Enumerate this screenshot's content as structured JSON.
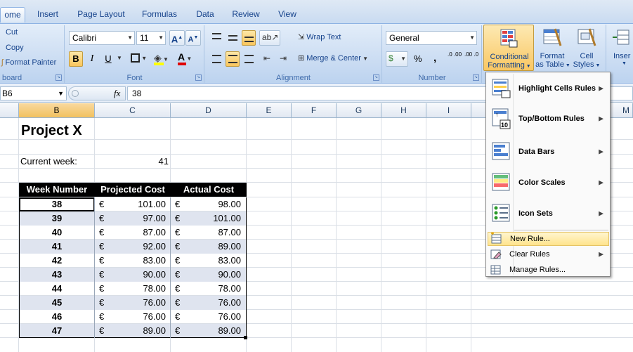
{
  "tabs": {
    "home": "ome",
    "insert": "Insert",
    "page_layout": "Page Layout",
    "formulas": "Formulas",
    "data": "Data",
    "review": "Review",
    "view": "View"
  },
  "clipboard": {
    "cut": "Cut",
    "copy": "Copy",
    "format_painter": "Format Painter",
    "label": "board"
  },
  "font": {
    "name": "Calibri",
    "size": "11",
    "label": "Font",
    "bold": "B",
    "italic": "I",
    "underline": "U",
    "grow": "A",
    "shrink": "A"
  },
  "alignment": {
    "wrap_text": "Wrap Text",
    "merge_center": "Merge & Center",
    "label": "Alignment"
  },
  "number": {
    "format": "General",
    "percent": "%",
    "comma": ",",
    "inc_decimal": ".0 .00",
    "dec_decimal": ".00 .0",
    "label": "Number"
  },
  "styles": {
    "conditional_formatting_1": "Conditional",
    "conditional_formatting_2": "Formatting",
    "format_table_1": "Format",
    "format_table_2": "as Table",
    "cell_styles_1": "Cell",
    "cell_styles_2": "Styles",
    "insert": "Inser"
  },
  "formula_bar": {
    "name_box": "B6",
    "fx": "fx",
    "value": "38"
  },
  "columns": [
    "B",
    "C",
    "D",
    "E",
    "F",
    "G",
    "H",
    "I",
    "M"
  ],
  "sheet": {
    "title": "Project X",
    "current_week_label": "Current week:",
    "current_week_value": "41",
    "headers": [
      "Week Number",
      "Projected Cost",
      "Actual Cost"
    ],
    "currency": "€",
    "rows": [
      {
        "week": "38",
        "projected": "101.00",
        "actual": "98.00"
      },
      {
        "week": "39",
        "projected": "97.00",
        "actual": "101.00"
      },
      {
        "week": "40",
        "projected": "87.00",
        "actual": "87.00"
      },
      {
        "week": "41",
        "projected": "92.00",
        "actual": "89.00"
      },
      {
        "week": "42",
        "projected": "83.00",
        "actual": "83.00"
      },
      {
        "week": "43",
        "projected": "90.00",
        "actual": "90.00"
      },
      {
        "week": "44",
        "projected": "78.00",
        "actual": "78.00"
      },
      {
        "week": "45",
        "projected": "76.00",
        "actual": "76.00"
      },
      {
        "week": "46",
        "projected": "76.00",
        "actual": "76.00"
      },
      {
        "week": "47",
        "projected": "89.00",
        "actual": "89.00"
      }
    ]
  },
  "menu": {
    "highlight_cells_rules": "Highlight Cells Rules",
    "top_bottom_rules": "Top/Bottom Rules",
    "data_bars": "Data Bars",
    "color_scales": "Color Scales",
    "icon_sets": "Icon Sets",
    "new_rule": "New Rule...",
    "clear_rules": "Clear Rules",
    "manage_rules": "Manage Rules..."
  },
  "colors": {
    "ribbon_text": "#15428b",
    "selected_header": "#f1c15f",
    "table_header_bg": "#000000",
    "row_band": "#dfe4ef",
    "menu_highlight": "#ffe48c"
  }
}
